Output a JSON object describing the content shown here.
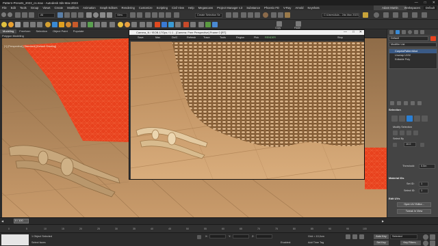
{
  "app": {
    "title": "Pattern-Presets_2023_cs.max - Autodesk 3ds Max 2023"
  },
  "menu": {
    "items": [
      "File",
      "Edit",
      "Tools",
      "Group",
      "Views",
      "Create",
      "Modifiers",
      "Animation",
      "Graph Editors",
      "Rendering",
      "Customize",
      "Scripting",
      "Civil View",
      "Help",
      "Megascans",
      "Project Manager v.3",
      "Substance",
      "Phoenix FD",
      "V-Ray",
      "Arnold",
      "Keyshots"
    ],
    "account": "Adam Martin",
    "workspaces_label": "Workspaces:",
    "workspace_value": "Default"
  },
  "toolbar": {
    "filter_dropdown": "All",
    "view_dropdown": "View",
    "selection_set": "Create Selection Se",
    "path": "C:\\Users\\Ada... 2ds Max 2023",
    "copy_label": "Copy",
    "paste_label": "Paste"
  },
  "ribbon": {
    "tabs": [
      "Modeling",
      "Freeform",
      "Selection",
      "Object Paint",
      "Populate"
    ],
    "active_tab": "Modeling",
    "sub_label": "Polygon Modeling"
  },
  "viewport": {
    "label": "[+] [Perspective] [Standard] [Default Shading]"
  },
  "render_window": {
    "title": "Camera_N / ISOB-17Ops / 1:1 - [Camera: Free Perspective] Frame 0 [RT]",
    "toolbar": {
      "save": "Save",
      "max": "Max",
      "ds": "Ds!C",
      "refresh": "Refresh",
      "trace": "Trace",
      "tools": "Tools",
      "region": "Region",
      "pick": "Pick",
      "render_state": "RENDER",
      "stop": "Stop"
    }
  },
  "command_panel": {
    "object_name": "Default",
    "modifier_list": "Modifier List",
    "stack": [
      "CarpetaPatternMod",
      "Unwrap UVW",
      "Editable Poly"
    ],
    "selection_rollout": "Selection",
    "modify_selection": "Modify Selection",
    "select_by": "Select By",
    "size_value": "10.0",
    "threshold_label": "Threshold:",
    "threshold_value": "0.0m",
    "material_ids_rollout": "Material IDs",
    "set_id_label": "Set ID:",
    "set_id_value": "1",
    "select_id_label": "Select ID:",
    "select_id_value": "1",
    "edit_uvs_rollout": "Edit UVs",
    "open_uv_editor": "Open UV Editor...",
    "tweak_in_view": "Tweak In View"
  },
  "timeline": {
    "frame_display": "0 / 100",
    "ticks": [
      "0",
      "5",
      "10",
      "15",
      "20",
      "25",
      "30",
      "35",
      "40",
      "45",
      "50",
      "55",
      "60",
      "65",
      "70",
      "75",
      "80",
      "85",
      "90",
      "95",
      "100"
    ]
  },
  "status": {
    "objects_selected": "1 Object Selected",
    "prompt": "Select faces",
    "x_label": "X:",
    "y_label": "Y:",
    "z_label": "Z:",
    "grid": "Grid = 10,0cm",
    "add_time_tag": "Add Time Tag",
    "enabled": "Enabled:",
    "auto_key": "Auto Key",
    "selected": "Selected",
    "set_key": "Set Key",
    "key_filters": "Key Filters..."
  },
  "colors": {
    "selection_red": "#e8421e",
    "wood_light": "#c89868",
    "ui_dark": "#2b2b2b",
    "accent_blue": "#2a7fd4"
  }
}
